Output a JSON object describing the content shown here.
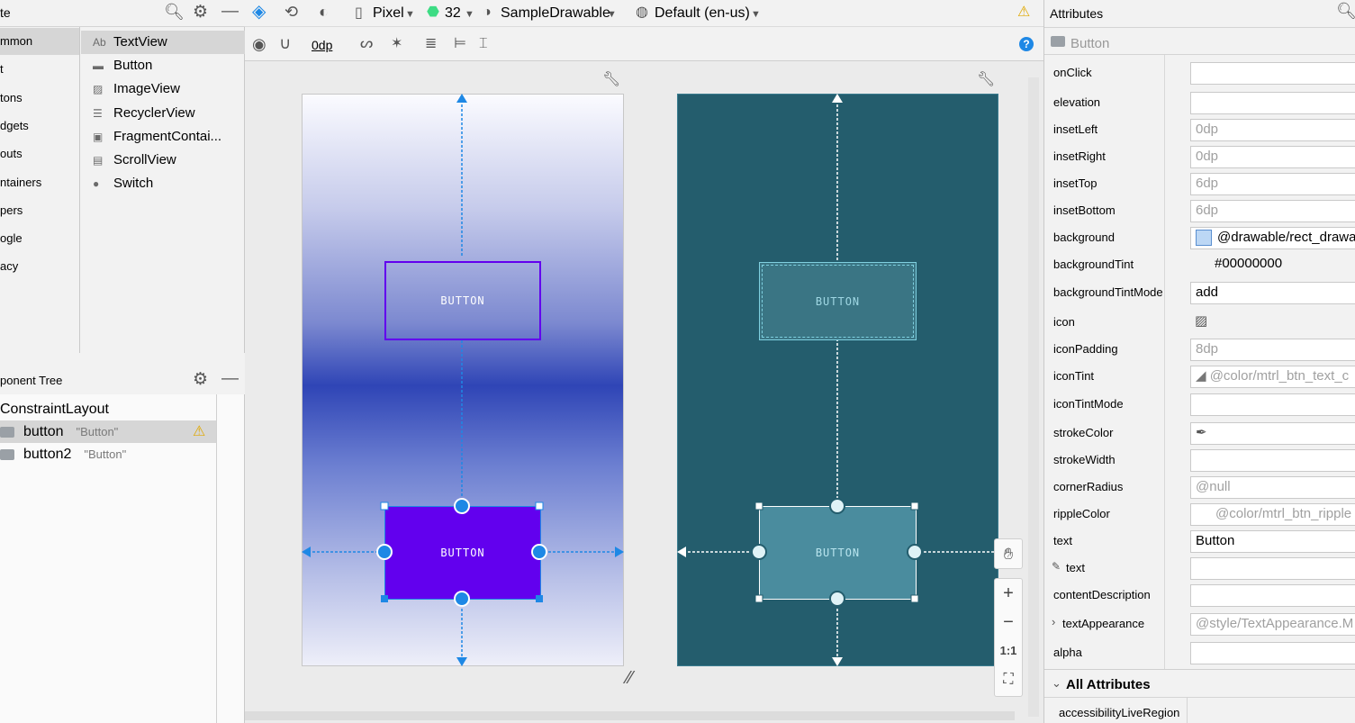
{
  "palette": {
    "title": "te",
    "categories": [
      "mmon",
      "t",
      "tons",
      "dgets",
      "outs",
      "ntainers",
      "pers",
      "ogle",
      "acy"
    ],
    "items": [
      {
        "label": "TextView",
        "icon": "Ab"
      },
      {
        "label": "Button",
        "icon": "button-icon"
      },
      {
        "label": "ImageView",
        "icon": "image-icon"
      },
      {
        "label": "RecyclerView",
        "icon": "list-icon"
      },
      {
        "label": "FragmentContai...",
        "icon": "fragment-icon"
      },
      {
        "label": "ScrollView",
        "icon": "scrollview-icon"
      },
      {
        "label": "Switch",
        "icon": "switch-icon"
      }
    ]
  },
  "tree": {
    "title": "ponent Tree",
    "root": "ConstraintLayout",
    "rows": [
      {
        "name": "button",
        "text": "\"Button\""
      },
      {
        "name": "button2",
        "text": "\"Button\""
      }
    ]
  },
  "toolbar": {
    "device": "Pixel",
    "api": "32",
    "theme": "SampleDrawable",
    "locale": "Default (en-us)",
    "margin": "0dp"
  },
  "canvas": {
    "button_label": "BUTTON"
  },
  "attributes": {
    "title": "Attributes",
    "component": "Button",
    "rows": [
      {
        "label": "onClick",
        "value": "",
        "style": "box"
      },
      {
        "label": "elevation",
        "value": "",
        "style": "box"
      },
      {
        "label": "insetLeft",
        "value": "0dp",
        "style": "gray"
      },
      {
        "label": "insetRight",
        "value": "0dp",
        "style": "gray"
      },
      {
        "label": "insetTop",
        "value": "6dp",
        "style": "gray"
      },
      {
        "label": "insetBottom",
        "value": "6dp",
        "style": "gray"
      },
      {
        "label": "background",
        "value": "@drawable/rect_drawa",
        "style": "swatch"
      },
      {
        "label": "backgroundTint",
        "value": "#00000000",
        "style": "plain"
      },
      {
        "label": "backgroundTintMode",
        "value": "add",
        "style": "box"
      },
      {
        "label": "icon",
        "value": "",
        "style": "image"
      },
      {
        "label": "iconPadding",
        "value": "8dp",
        "style": "gray"
      },
      {
        "label": "iconTint",
        "value": "@color/mtrl_btn_text_c",
        "style": "graytri"
      },
      {
        "label": "iconTintMode",
        "value": "",
        "style": "box"
      },
      {
        "label": "strokeColor",
        "value": "",
        "style": "picker"
      },
      {
        "label": "strokeWidth",
        "value": "",
        "style": "box"
      },
      {
        "label": "cornerRadius",
        "value": "@null",
        "style": "gray"
      },
      {
        "label": "rippleColor",
        "value": "@color/mtrl_btn_ripple",
        "style": "graypad"
      },
      {
        "label": "text",
        "value": "Button",
        "style": "box"
      },
      {
        "label": "text",
        "value": "",
        "style": "box"
      },
      {
        "label": "contentDescription",
        "value": "",
        "style": "box"
      },
      {
        "label": "textAppearance",
        "value": "@style/TextAppearance.M",
        "style": "gray"
      },
      {
        "label": "alpha",
        "value": "",
        "style": "box"
      }
    ],
    "all_attributes": "All Attributes",
    "last_row": "accessibilityLiveRegion"
  },
  "zoom": {
    "plus": "+",
    "minus": "−",
    "one_to_one": "1:1"
  },
  "colors": {
    "accent": "#1e88e5",
    "button_purple": "#6200ee",
    "blueprint": "#245d6d"
  }
}
